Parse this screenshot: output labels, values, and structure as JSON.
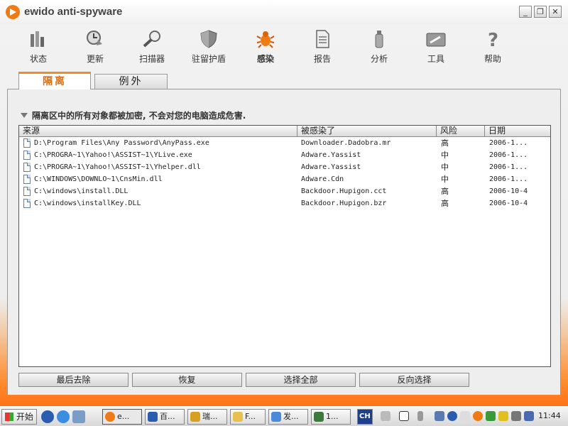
{
  "app": {
    "title": "ewido anti-spyware"
  },
  "window_controls": {
    "minimize": "_",
    "maximize": "❐",
    "close": "✕"
  },
  "toolbar": [
    {
      "label": "状态",
      "icon": "status-icon"
    },
    {
      "label": "更新",
      "icon": "update-icon"
    },
    {
      "label": "扫描器",
      "icon": "scanner-icon"
    },
    {
      "label": "驻留护盾",
      "icon": "shield-icon"
    },
    {
      "label": "感染",
      "icon": "bug-icon",
      "active": true
    },
    {
      "label": "报告",
      "icon": "report-icon"
    },
    {
      "label": "分析",
      "icon": "analysis-icon"
    },
    {
      "label": "工具",
      "icon": "tools-icon"
    },
    {
      "label": "帮助",
      "icon": "help-icon"
    }
  ],
  "tabs": {
    "quarantine": "隔离",
    "exceptions": "例外"
  },
  "note": "隔离区中的所有对象都被加密, 不会对您的电脑造成危害.",
  "table": {
    "headers": {
      "source": "来源",
      "infected": "被感染了",
      "risk": "风险",
      "date": "日期"
    },
    "rows": [
      {
        "source": "D:\\Program Files\\Any Password\\AnyPass.exe",
        "infected": "Downloader.Dadobra.mr",
        "risk": "高",
        "date": "2006-1..."
      },
      {
        "source": "C:\\PROGRA~1\\Yahoo!\\ASSIST~1\\YLive.exe",
        "infected": "Adware.Yassist",
        "risk": "中",
        "date": "2006-1..."
      },
      {
        "source": "C:\\PROGRA~1\\Yahoo!\\ASSIST~1\\Yhelper.dll",
        "infected": "Adware.Yassist",
        "risk": "中",
        "date": "2006-1..."
      },
      {
        "source": "C:\\WINDOWS\\DOWNLO~1\\CnsMin.dll",
        "infected": "Adware.Cdn",
        "risk": "中",
        "date": "2006-1..."
      },
      {
        "source": "C:\\windows\\install.DLL",
        "infected": "Backdoor.Hupigon.cct",
        "risk": "高",
        "date": "2006-10-4"
      },
      {
        "source": "C:\\windows\\installKey.DLL",
        "infected": "Backdoor.Hupigon.bzr",
        "risk": "高",
        "date": "2006-10-4"
      }
    ]
  },
  "buttons": {
    "delete": "最后去除",
    "restore": "恢复",
    "select_all": "选择全部",
    "invert": "反向选择"
  },
  "taskbar": {
    "start": "开始",
    "tasks": [
      "e...",
      "百...",
      "瑞...",
      "F...",
      "发...",
      "1..."
    ],
    "lang": "CH",
    "clock": "11:44"
  },
  "colors": {
    "accent": "#f08a24",
    "taskbar_bg": "#dcdcdc"
  }
}
